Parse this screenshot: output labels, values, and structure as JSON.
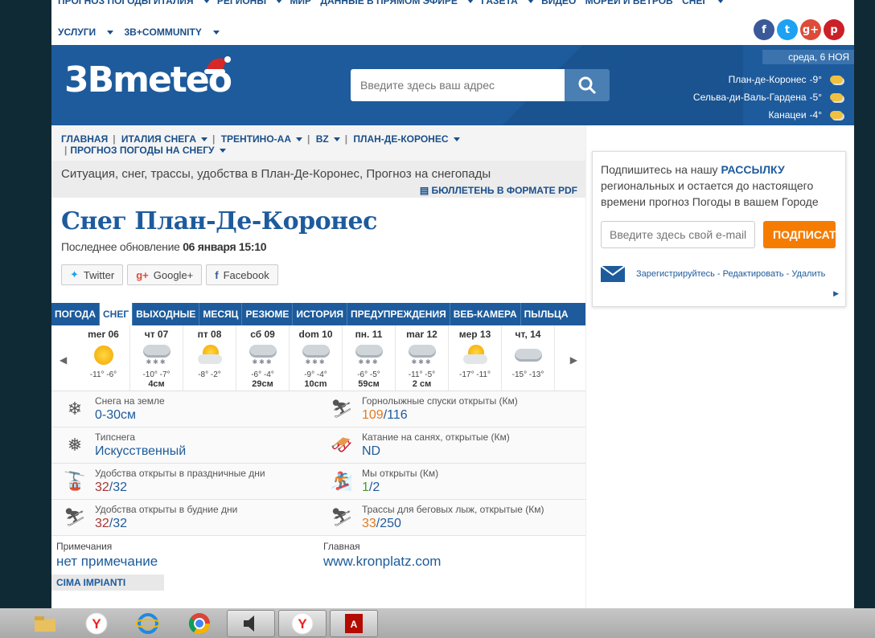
{
  "topnav": {
    "row1": [
      "ПРОГНОЗ ПОГОДЫ ИТАЛИЯ",
      "РЕГИОНЫ",
      "МИР",
      "ДАННЫЕ В ПРЯМОМ ЭФИРЕ",
      "ГАЗЕТА",
      "ВИДЕО",
      "МОРЕЙ И ВЕТРОВ",
      "СНЕГ"
    ],
    "services": "УСЛУГИ",
    "community": "3B+COMMUNITY"
  },
  "social": [
    "f",
    "t",
    "g+",
    "p"
  ],
  "header": {
    "logo": "3Bmeteo",
    "search_placeholder": "Введите здесь ваш адрес",
    "date": "среда, 6 НОЯ",
    "cities": [
      {
        "name": "План-де-Коронес",
        "temp": "-9°"
      },
      {
        "name": "Сельва-ди-Валь-Гардена",
        "temp": "-5°"
      },
      {
        "name": "Канацеи",
        "temp": "-4°"
      }
    ]
  },
  "breadcrumb": {
    "items": [
      "ГЛАВНАЯ",
      "ИТАЛИЯ СНЕГА",
      "ТРЕНТИНО-АА",
      "BZ",
      "ПЛАН-ДЕ-КОРОНЕС"
    ],
    "item2": "ПРОГНОЗ ПОГОДЫ НА СНЕГУ"
  },
  "situation": {
    "text": "Ситуация, снег, трассы, удобства в План-Де-Коронес, Прогноз на снегопады",
    "pdf_label": "БЮЛЛЕТЕНЬ В ФОРМАТЕ PDF"
  },
  "title": "Снег План-Де-Коронес",
  "updated": {
    "label": "Последнее обновление",
    "value": "06 января 15:10"
  },
  "share": {
    "twitter": "Twitter",
    "google": "Google+",
    "facebook": "Facebook"
  },
  "tabs": [
    "ПОГОДА",
    "СНЕГ",
    "ВЫХОДНЫЕ",
    "МЕСЯЦ",
    "РЕЗЮМЕ",
    "ИСТОРИЯ",
    "ПРЕДУПРЕЖДЕНИЯ",
    "ВЕБ-КАМЕРА",
    "ПЫЛЬЦА"
  ],
  "forecast": [
    {
      "day": "mer 06",
      "icon": "sun",
      "temp": "-11° -6°",
      "snow": ""
    },
    {
      "day": "чт 07",
      "icon": "snow",
      "temp": "-10° -7°",
      "snow": "4см"
    },
    {
      "day": "пт 08",
      "icon": "sun-cloud",
      "temp": "-8° -2°",
      "snow": ""
    },
    {
      "day": "сб 09",
      "icon": "snow",
      "temp": "-6° -4°",
      "snow": "29см"
    },
    {
      "day": "dom 10",
      "icon": "snow",
      "temp": "-9° -4°",
      "snow": "10cm"
    },
    {
      "day": "пн. 11",
      "icon": "snow",
      "temp": "-6° -5°",
      "snow": "59см"
    },
    {
      "day": "mar 12",
      "icon": "snow",
      "temp": "-11° -5°",
      "snow": "2 см"
    },
    {
      "day": "мер 13",
      "icon": "sun-cloud",
      "temp": "-17° -11°",
      "snow": ""
    },
    {
      "day": "чт, 14",
      "icon": "cloud",
      "temp": "-15° -13°",
      "snow": ""
    }
  ],
  "info": {
    "snow_ground": {
      "label": "Снега на земле",
      "value": "0-30см"
    },
    "ski_open": {
      "label": "Горнолыжные спуски открыты (Км)",
      "v1": "109",
      "v2": "116"
    },
    "snow_type": {
      "label": "Типснега",
      "value": "Искусственный"
    },
    "sled": {
      "label": "Катание на санях, открытые (Км)",
      "value": "ND"
    },
    "holiday": {
      "label": "Удобства открыты в праздничные дни",
      "v1": "32",
      "v2": "32"
    },
    "we_open": {
      "label": "Мы открыты (Км)",
      "v1": "1",
      "v2": "2"
    },
    "weekday": {
      "label": "Удобства открыты в будние дни",
      "v1": "32",
      "v2": "32"
    },
    "cross": {
      "label": "Трассы для беговых лыж, открытые (Км)",
      "v1": "33",
      "v2": "250"
    }
  },
  "notes": {
    "label": "Примечания",
    "value": "нет примечание",
    "home_label": "Главная",
    "home_value": "www.kronplatz.com"
  },
  "cima": "CIMA IMPIANTI",
  "newsletter": {
    "text1": "Подпишитесь на нашу ",
    "bold": "РАССЫЛКУ",
    "text2": "региональных и остается до настоящего времени прогноз Погоды в вашем Городе",
    "placeholder": "Введите здесь свой e-mail",
    "button": "ПОДПИСАТЬСЯ",
    "links": "Зарегистрируйтесь - Редактировать - Удалить"
  },
  "taskbar": [
    "explorer",
    "yandex",
    "ie",
    "chrome",
    "speaker",
    "yandex-active",
    "pdf"
  ]
}
